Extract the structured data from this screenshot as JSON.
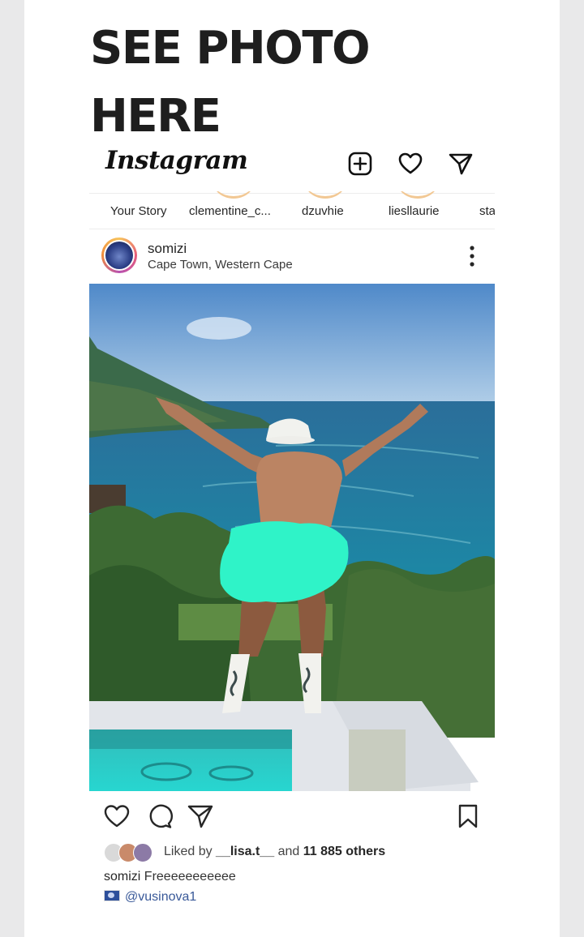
{
  "headline": {
    "line1": "SEE PHOTO",
    "line2": "HERE"
  },
  "instagram": {
    "logo": "Instagram",
    "top_icons": [
      "new-post-icon",
      "activity-heart-icon",
      "direct-message-icon"
    ],
    "stories": [
      "Your Story",
      "clementine_c...",
      "dzuvhie",
      "liesllaurie",
      "sta"
    ],
    "story_ring_color": "#f2c894",
    "post": {
      "username": "somizi",
      "location": "Cape Town, Western Cape",
      "more_icon": "more-options-icon",
      "image_alt": "Man in white bucket hat and socks with arms raised on a rooftop pool overlooking the sea",
      "censor_color": "#2ff3c8",
      "likes": {
        "prefix": "Liked by",
        "user": "__lisa.t__",
        "mid": "and",
        "count": "11 885 others"
      },
      "caption_user": "somizi",
      "caption_text": "Freeeeeeeeeee",
      "comment": "@vusinova1"
    }
  }
}
